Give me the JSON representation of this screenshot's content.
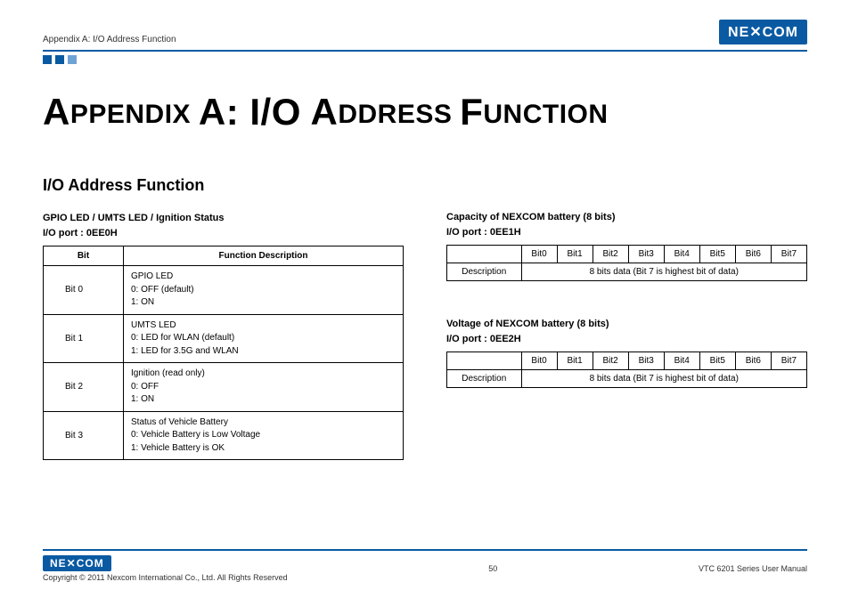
{
  "brand": "NE✕COM",
  "header": {
    "breadcrumb": "Appendix A: I/O Address Function"
  },
  "title_html": "APPENDIX A: I/O ADDRESS FUNCTION",
  "section_title": "I/O Address Function",
  "left": {
    "subhead_line1": "GPIO LED / UMTS LED / Ignition Status",
    "subhead_line2": "I/O port : 0EE0H",
    "table": {
      "headers": [
        "Bit",
        "Function Description"
      ],
      "rows": [
        {
          "bit": "Bit 0",
          "lines": [
            "GPIO LED",
            "0: OFF (default)",
            "1: ON"
          ]
        },
        {
          "bit": "Bit 1",
          "lines": [
            "UMTS LED",
            "0: LED for WLAN (default)",
            "1: LED for 3.5G and WLAN"
          ]
        },
        {
          "bit": "Bit 2",
          "lines": [
            "Ignition (read only)",
            "0: OFF",
            "1: ON"
          ]
        },
        {
          "bit": "Bit 3",
          "lines": [
            "Status of Vehicle Battery",
            "0: Vehicle Battery is Low Voltage",
            "1: Vehicle Battery is OK"
          ]
        }
      ]
    }
  },
  "right": {
    "block1": {
      "subhead_line1": "Capacity of NEXCOM battery (8 bits)",
      "subhead_line2": "I/O port : 0EE1H",
      "bits": [
        "Bit0",
        "Bit1",
        "Bit2",
        "Bit3",
        "Bit4",
        "Bit5",
        "Bit6",
        "Bit7"
      ],
      "desc_label": "Description",
      "desc_text": "8 bits data (Bit 7 is highest bit of data)"
    },
    "block2": {
      "subhead_line1": "Voltage of NEXCOM battery (8 bits)",
      "subhead_line2": "I/O port : 0EE2H",
      "bits": [
        "Bit0",
        "Bit1",
        "Bit2",
        "Bit3",
        "Bit4",
        "Bit5",
        "Bit6",
        "Bit7"
      ],
      "desc_label": "Description",
      "desc_text": "8 bits data (Bit 7 is highest bit of data)"
    }
  },
  "footer": {
    "copyright": "Copyright © 2011 Nexcom International Co., Ltd. All Rights Reserved",
    "page": "50",
    "manual": "VTC 6201 Series User Manual"
  }
}
